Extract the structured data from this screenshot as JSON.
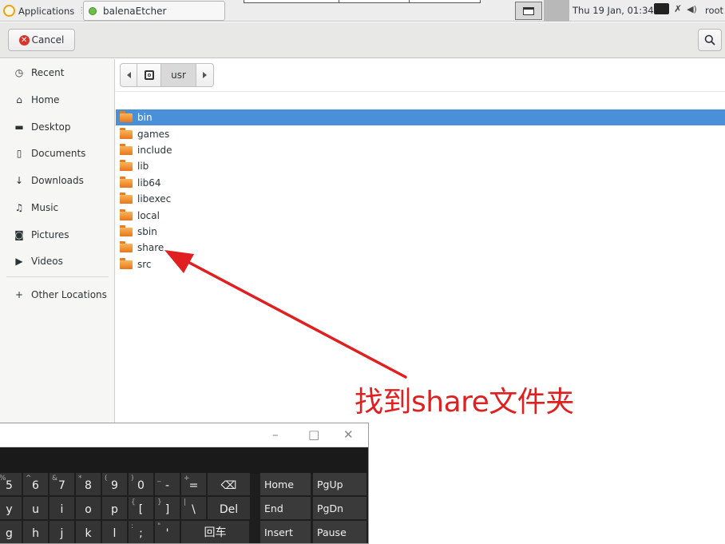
{
  "taskbar": {
    "applications_label": "Applications",
    "applications_ellipsis": "⋮",
    "task_label": "balenaEtcher",
    "clock": "Thu 19 Jan, 01:34",
    "user": "root"
  },
  "header": {
    "cancel_label": "Cancel"
  },
  "sidebar": {
    "items": [
      {
        "label": "Recent",
        "icon": "clock-icon"
      },
      {
        "label": "Home",
        "icon": "home-icon"
      },
      {
        "label": "Desktop",
        "icon": "folder-icon"
      },
      {
        "label": "Documents",
        "icon": "document-icon"
      },
      {
        "label": "Downloads",
        "icon": "download-icon"
      },
      {
        "label": "Music",
        "icon": "music-icon"
      },
      {
        "label": "Pictures",
        "icon": "camera-icon"
      },
      {
        "label": "Videos",
        "icon": "video-icon"
      },
      {
        "label": "Other Locations",
        "icon": "plus-icon"
      }
    ]
  },
  "pathbar": {
    "current": "usr"
  },
  "files": [
    {
      "name": "bin",
      "selected": true
    },
    {
      "name": "games"
    },
    {
      "name": "include"
    },
    {
      "name": "lib"
    },
    {
      "name": "lib64"
    },
    {
      "name": "libexec"
    },
    {
      "name": "local"
    },
    {
      "name": "sbin"
    },
    {
      "name": "share"
    },
    {
      "name": "src"
    }
  ],
  "annotation": {
    "text": "找到share文件夹",
    "color": "#e02020"
  },
  "keyboard": {
    "title_minimize": "–",
    "title_maximize": "□",
    "title_close": "✕",
    "row1": [
      {
        "main": "5",
        "shift": "%"
      },
      {
        "main": "6",
        "shift": "^"
      },
      {
        "main": "7",
        "shift": "&"
      },
      {
        "main": "8",
        "shift": "*"
      },
      {
        "main": "9",
        "shift": "("
      },
      {
        "main": "0",
        "shift": ")"
      },
      {
        "main": "-",
        "shift": "_"
      },
      {
        "main": "=",
        "shift": "+"
      },
      {
        "main": "⌫",
        "shift": ""
      }
    ],
    "row2": [
      {
        "main": "y",
        "shift": ""
      },
      {
        "main": "u",
        "shift": ""
      },
      {
        "main": "i",
        "shift": ""
      },
      {
        "main": "o",
        "shift": ""
      },
      {
        "main": "p",
        "shift": ""
      },
      {
        "main": "[",
        "shift": "{"
      },
      {
        "main": "]",
        "shift": "}"
      },
      {
        "main": "\\",
        "shift": "|"
      },
      {
        "main": "Del",
        "shift": ""
      }
    ],
    "row3": [
      {
        "main": "g",
        "shift": ""
      },
      {
        "main": "h",
        "shift": ""
      },
      {
        "main": "j",
        "shift": ""
      },
      {
        "main": "k",
        "shift": ""
      },
      {
        "main": "l",
        "shift": ""
      },
      {
        "main": ";",
        "shift": ":"
      },
      {
        "main": "'",
        "shift": "\""
      },
      {
        "main": "回车",
        "shift": ""
      }
    ],
    "nav": [
      [
        "Home",
        "PgUp"
      ],
      [
        "End",
        "PgDn"
      ],
      [
        "Insert",
        "Pause"
      ]
    ]
  }
}
